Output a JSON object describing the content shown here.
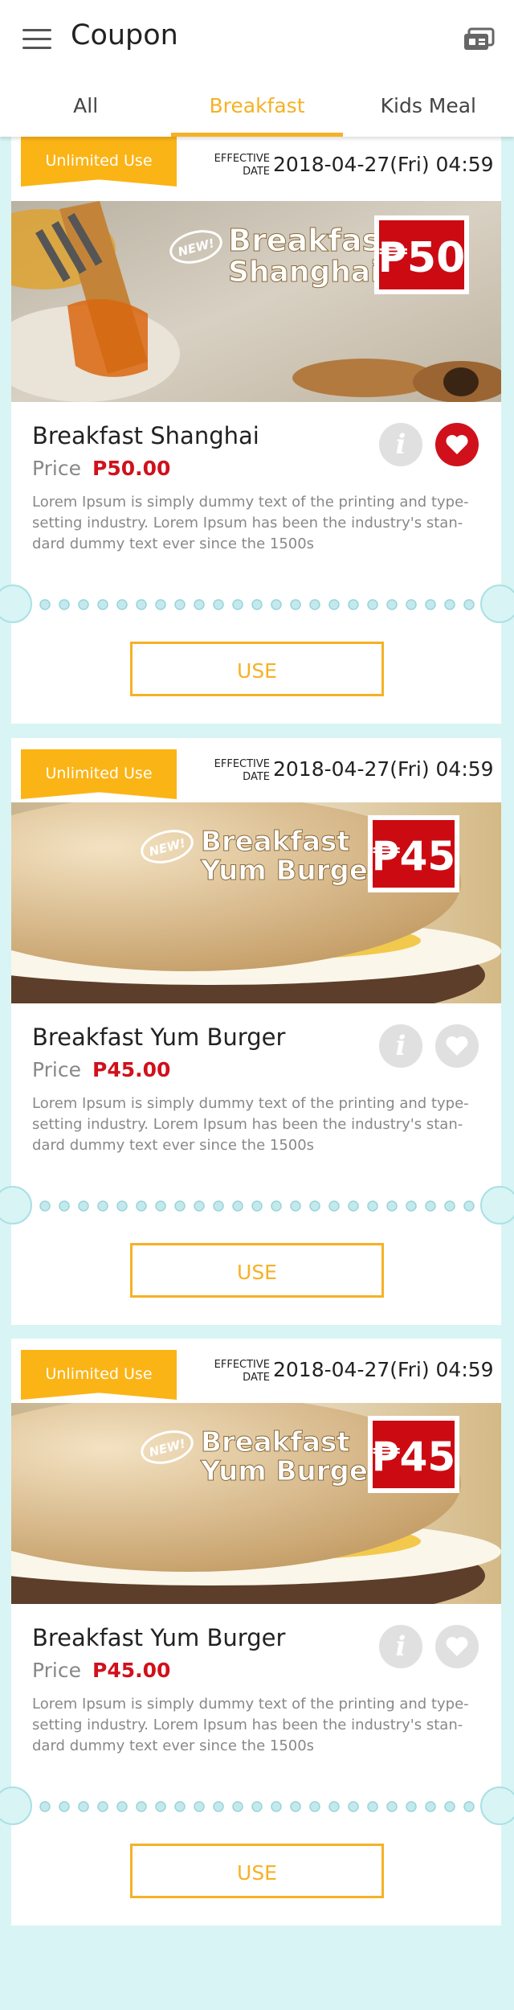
{
  "header": {
    "title": "Coupon",
    "menu_icon": "hamburger-menu-icon",
    "wallet_icon": "coupon-wallet-icon"
  },
  "tabs": [
    {
      "label": "All",
      "active": false
    },
    {
      "label": "Breakfast",
      "active": true
    },
    {
      "label": "Kids Meal",
      "active": false
    }
  ],
  "colors": {
    "accent": "#f6b125",
    "price": "#d0111b",
    "background": "#d9f4f4",
    "badge": "#fbb416"
  },
  "coupons": [
    {
      "badge": "Unlimited Use",
      "effective_label": "EFFECTIVE DATE",
      "effective_date": "2018-04-27(Fri) 04:59",
      "banner_new": "NEW!",
      "banner_line1": "Breakfast",
      "banner_line2": "Shanghai",
      "banner_price": "₱50",
      "name": "Breakfast Shanghai",
      "price_label": "Price",
      "price_value": "P50.00",
      "description": "Lorem Ipsum is simply dummy text of the printing and type-setting industry. Lorem Ipsum has been the industry's stan-dard dummy text ever since the 1500s",
      "favorite": true,
      "use_label": "USE"
    },
    {
      "badge": "Unlimited Use",
      "effective_label": "EFFECTIVE DATE",
      "effective_date": "2018-04-27(Fri) 04:59",
      "banner_new": "NEW!",
      "banner_line1": "Breakfast",
      "banner_line2": "Yum Burger",
      "banner_price": "₱45",
      "name": "Breakfast Yum Burger",
      "price_label": "Price",
      "price_value": "P45.00",
      "description": "Lorem Ipsum is simply dummy text of the printing and type-setting industry. Lorem Ipsum has been the industry's stan-dard dummy text ever since the 1500s",
      "favorite": false,
      "use_label": "USE"
    },
    {
      "badge": "Unlimited Use",
      "effective_label": "EFFECTIVE DATE",
      "effective_date": "2018-04-27(Fri) 04:59",
      "banner_new": "NEW!",
      "banner_line1": "Breakfast",
      "banner_line2": "Yum Burger",
      "banner_price": "₱45",
      "name": "Breakfast Yum Burger",
      "price_label": "Price",
      "price_value": "P45.00",
      "description": "Lorem Ipsum is simply dummy text of the printing and type-setting industry. Lorem Ipsum has been the industry's stan-dard dummy text ever since the 1500s",
      "favorite": false,
      "use_label": "USE"
    }
  ]
}
